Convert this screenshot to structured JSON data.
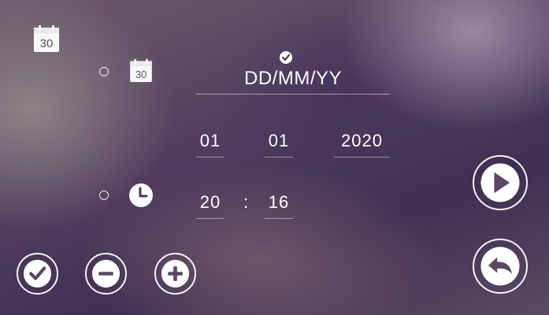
{
  "header": {
    "calendar_icon_number": "30"
  },
  "format": {
    "calendar_icon_number": "30",
    "selected_check": "check-icon",
    "label": "DD/MM/YY"
  },
  "date": {
    "day": "01",
    "month": "01",
    "year": "2020"
  },
  "time": {
    "hour": "20",
    "separator": ":",
    "minute": "16"
  },
  "buttons": {
    "confirm": "check-icon",
    "decrease": "minus-icon",
    "increase": "plus-icon",
    "next": "play-icon",
    "back": "back-arrow-icon"
  }
}
